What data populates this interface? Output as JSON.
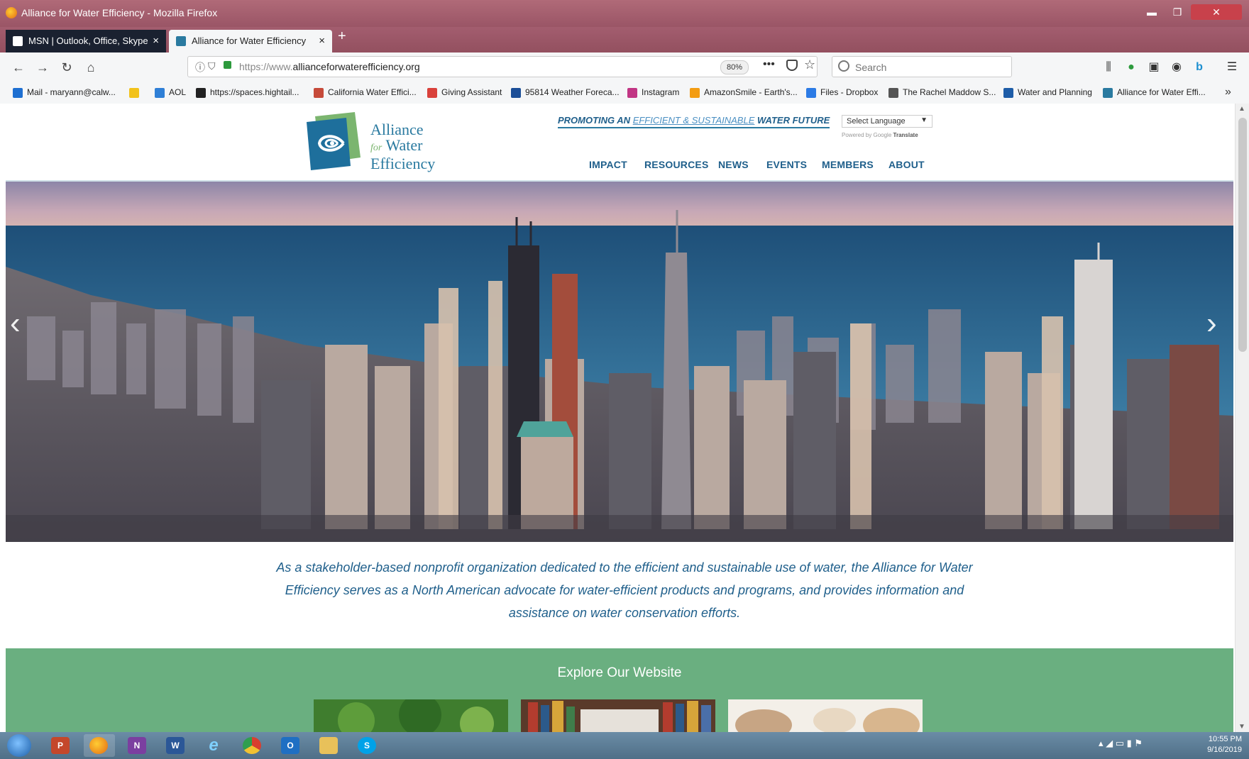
{
  "window": {
    "title": "Alliance for Water Efficiency - Mozilla Firefox",
    "controls": {
      "minimize": "▬",
      "maximize": "❐",
      "close": "✕"
    }
  },
  "tabs": [
    {
      "label": "MSN | Outlook, Office, Skype",
      "icon": "msn-icon",
      "color": "#ffffff"
    },
    {
      "label": "Alliance for Water Efficiency",
      "icon": "awe-icon",
      "color": "#2a7aa0"
    }
  ],
  "nav": {
    "url_prefix": "https://www.",
    "url_domain": "allianceforwaterefficiency.org",
    "zoom": "80%",
    "search_placeholder": "Search"
  },
  "bookmarks": [
    {
      "label": "Mail - maryann@calw...",
      "color": "#1e6fd1"
    },
    {
      "label": "",
      "color": "#f2c21b"
    },
    {
      "label": "AOL",
      "color": "#2f7fd6"
    },
    {
      "label": "https://spaces.hightail...",
      "color": "#222222"
    },
    {
      "label": "California Water Effici...",
      "color": "#c64a3a"
    },
    {
      "label": "Giving Assistant",
      "color": "#d9413b"
    },
    {
      "label": "95814 Weather Foreca...",
      "color": "#1b4e97"
    },
    {
      "label": "Instagram",
      "color": "#c13584"
    },
    {
      "label": "AmazonSmile - Earth's...",
      "color": "#f39c12"
    },
    {
      "label": "Files - Dropbox",
      "color": "#2c7be5"
    },
    {
      "label": "The Rachel Maddow S...",
      "color": "#555555"
    },
    {
      "label": "Water and Planning",
      "color": "#1e5da8"
    },
    {
      "label": "Alliance for Water Effi...",
      "color": "#2a7aa0"
    }
  ],
  "site": {
    "logo": {
      "line1": "Alliance",
      "for": "for",
      "line2": "Water",
      "line3": "Efficiency"
    },
    "tagline": {
      "pre": "PROMOTING AN ",
      "accent": "EFFICIENT & SUSTAINABLE",
      "post": " WATER FUTURE"
    },
    "language_select": "Select Language",
    "powered_by": "Powered by",
    "google": "Google",
    "translate": "Translate",
    "menu": [
      "IMPACT",
      "RESOURCES",
      "NEWS",
      "EVENTS",
      "MEMBERS",
      "ABOUT"
    ],
    "hero_prev": "‹",
    "hero_next": "›",
    "mission": "As a stakeholder-based nonprofit organization dedicated to the efficient and sustainable use of water, the Alliance for Water Efficiency serves as a North American advocate for water-efficient products and programs, and provides information and assistance on water conservation efforts.",
    "explore_title": "Explore Our Website",
    "brand_blue": "#1f5f8b",
    "brand_green": "#6aaf80"
  },
  "taskbar": {
    "apps": [
      {
        "name": "powerpoint-app",
        "glyph": "P",
        "color": "#c4472b"
      },
      {
        "name": "firefox-app",
        "glyph": "",
        "color": "#e8781a"
      },
      {
        "name": "onenote-app",
        "glyph": "N",
        "color": "#7b3fa0"
      },
      {
        "name": "word-app",
        "glyph": "W",
        "color": "#2b5797"
      },
      {
        "name": "ie-app",
        "glyph": "e",
        "color": "#1c8fd8"
      },
      {
        "name": "chrome-app",
        "glyph": "",
        "color": "#e0a321"
      },
      {
        "name": "outlook-app",
        "glyph": "O",
        "color": "#1f6fc3"
      },
      {
        "name": "explorer-app",
        "glyph": "",
        "color": "#e8c15a"
      },
      {
        "name": "skype-app",
        "glyph": "S",
        "color": "#00a2e8"
      }
    ],
    "time": "10:55 PM",
    "date": "9/16/2019"
  }
}
